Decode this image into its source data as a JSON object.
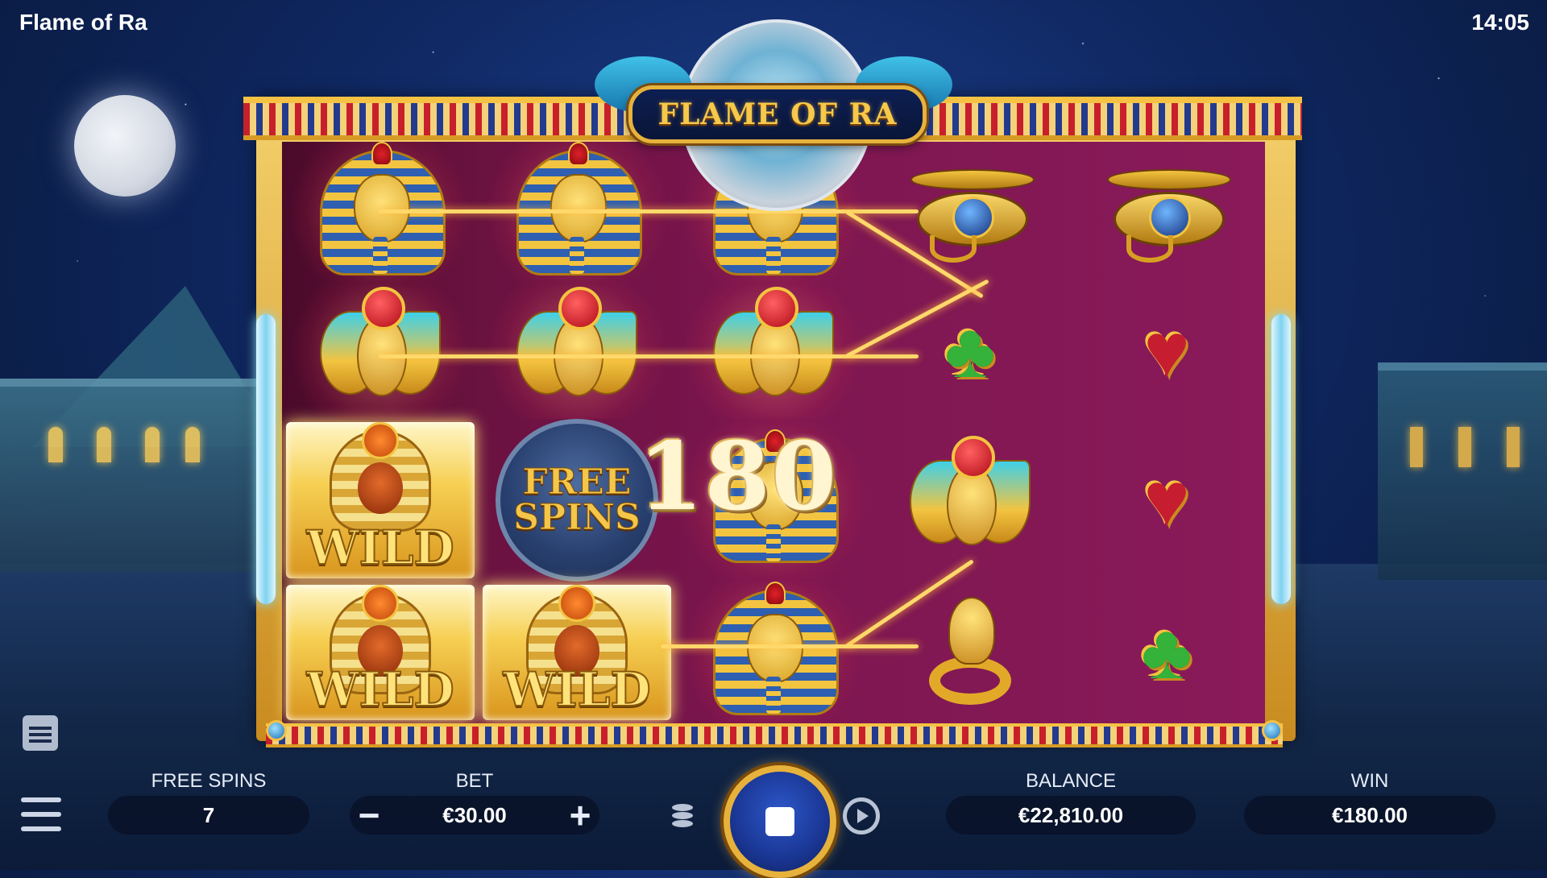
{
  "app": {
    "title": "Flame of Ra",
    "clock": "14:05"
  },
  "logo": {
    "text": "FLAME OF RA"
  },
  "reels": {
    "rows": [
      [
        "pharaoh",
        "pharaoh",
        "pharaoh",
        "eye-of-horus",
        "eye-of-horus"
      ],
      [
        "scarab",
        "scarab",
        "scarab",
        "club",
        "heart"
      ],
      [
        "wild",
        "free-spins",
        "pharaoh",
        "scarab",
        "heart"
      ],
      [
        "wild",
        "wild",
        "pharaoh",
        "cobra",
        "club"
      ]
    ],
    "wild_label": "WILD",
    "free_spins_symbol": {
      "line1": "FREE",
      "line2": "SPINS"
    }
  },
  "win_display": {
    "amount": "180"
  },
  "hud": {
    "free_spins": {
      "label": "FREE SPINS",
      "value": "7"
    },
    "bet": {
      "label": "BET",
      "value": "€30.00",
      "minus": "−",
      "plus": "+"
    },
    "balance": {
      "label": "BALANCE",
      "value": "€22,810.00"
    },
    "win": {
      "label": "WIN",
      "value": "€180.00"
    }
  },
  "colors": {
    "gold": "#f3c440",
    "reel_bg": "#7d1650",
    "hud_box": "#081026",
    "payline": "#ffd86a"
  }
}
